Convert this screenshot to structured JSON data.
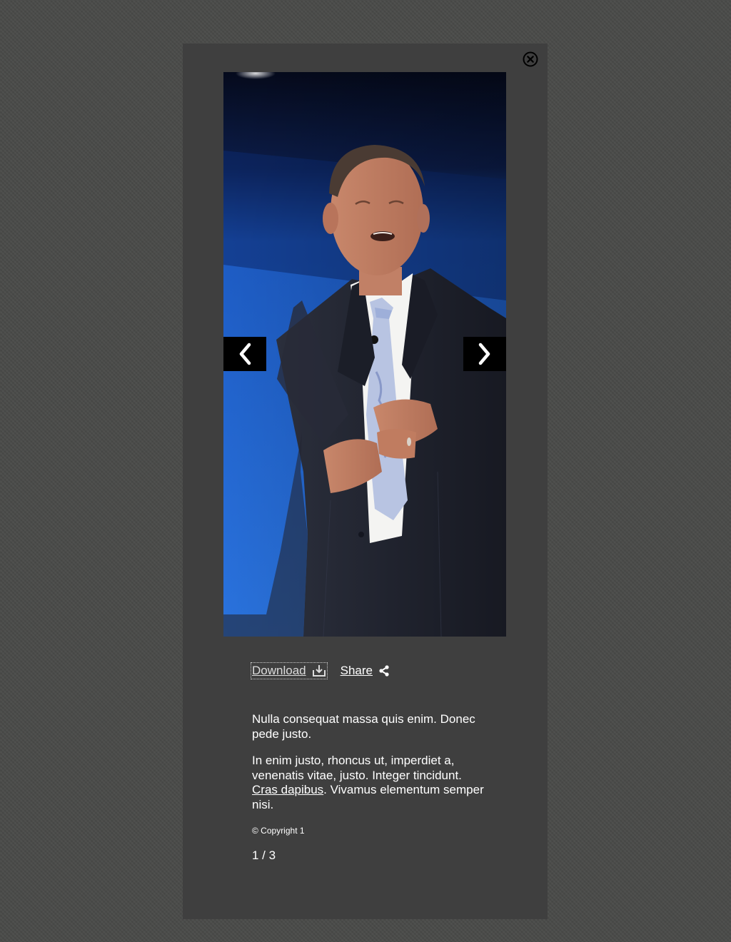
{
  "lightbox": {
    "close_icon": "close-circle-icon",
    "image_alt": "Man in a pinstriped suit speaking on stage against a blue background",
    "prev_icon": "chevron-left-icon",
    "next_icon": "chevron-right-icon",
    "actions": {
      "download_label": "Download",
      "download_icon": "download-icon",
      "share_label": "Share",
      "share_icon": "share-icon"
    },
    "caption": {
      "paragraph1": "Nulla consequat massa quis enim. Donec pede justo.",
      "paragraph2_before_link": "In enim justo, rhoncus ut, imperdiet a, venenatis vitae, justo. Integer tincidunt. ",
      "paragraph2_link": "Cras dapibus",
      "paragraph2_after_link": ". Vivamus elementum semper nisi."
    },
    "copyright": "© Copyright 1",
    "counter": "1 / 3"
  },
  "colors": {
    "page_background": "#4a4b49",
    "modal_background": "#3f3f3f",
    "nav_button_background": "#000000",
    "text": "#ffffff"
  }
}
